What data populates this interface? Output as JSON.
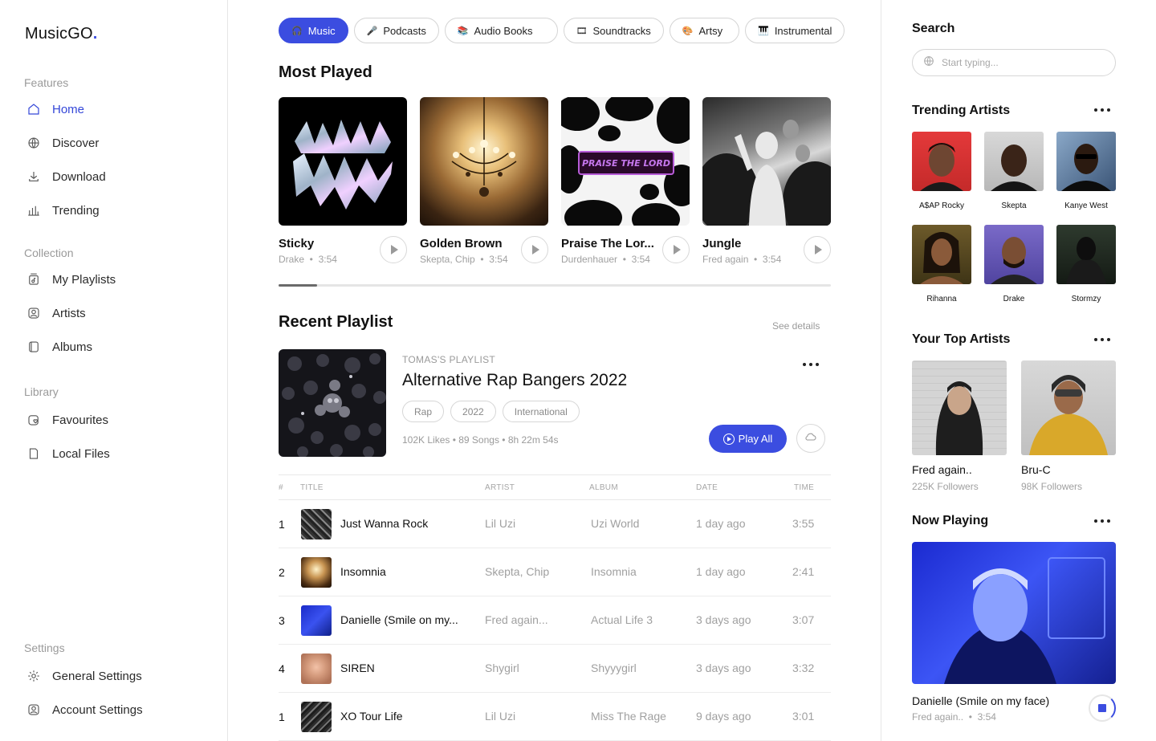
{
  "app": {
    "logo_main": "MusicGO",
    "logo_dot": "."
  },
  "sidebar": {
    "sections": {
      "features": "Features",
      "collection": "Collection",
      "library": "Library",
      "settings": "Settings"
    },
    "items": {
      "home": "Home",
      "discover": "Discover",
      "download": "Download",
      "trending": "Trending",
      "my_playlists": "My Playlists",
      "artists": "Artists",
      "albums": "Albums",
      "favourites": "Favourites",
      "local_files": "Local Files",
      "general_settings": "General Settings",
      "account_settings": "Account Settings"
    },
    "active_item": "home"
  },
  "categories": [
    {
      "label": "Music",
      "icon": "headphones-icon",
      "active": true
    },
    {
      "label": "Podcasts",
      "icon": "microphone-icon",
      "active": false
    },
    {
      "label": "Audio Books",
      "icon": "books-icon",
      "active": false
    },
    {
      "label": "Soundtracks",
      "icon": "film-icon",
      "active": false
    },
    {
      "label": "Artsy",
      "icon": "palette-icon",
      "active": false
    },
    {
      "label": "Instrumental",
      "icon": "piano-icon",
      "active": false
    }
  ],
  "most_played": {
    "heading": "Most Played",
    "items": [
      {
        "title": "Sticky",
        "artist": "Drake",
        "duration": "3:54"
      },
      {
        "title": "Golden Brown",
        "artist": "Skepta, Chip",
        "duration": "3:54"
      },
      {
        "title": "Praise The Lor...",
        "artist": "Durdenhauer",
        "duration": "3:54"
      },
      {
        "title": "Jungle",
        "artist": "Fred again",
        "duration": "3:54"
      }
    ],
    "scroll_progress": 0.07
  },
  "recent_playlist": {
    "heading": "Recent Playlist",
    "see_details": "See details",
    "kicker": "TOMAS'S PLAYLIST",
    "title": "Alternative Rap Bangers 2022",
    "tags": [
      "Rap",
      "2022",
      "International"
    ],
    "meta": "102K Likes • 89 Songs • 8h 22m 54s",
    "play_all": "Play All"
  },
  "track_table": {
    "headers": {
      "num": "#",
      "title": "TITLE",
      "artist": "ARTIST",
      "album": "ALBUM",
      "date": "DATE",
      "time": "TIME"
    },
    "rows": [
      {
        "num": "1",
        "title": "Just Wanna Rock",
        "artist": "Lil Uzi",
        "album": "Uzi World",
        "date": "1 day ago",
        "time": "3:55"
      },
      {
        "num": "2",
        "title": "Insomnia",
        "artist": "Skepta, Chip",
        "album": "Insomnia",
        "date": "1 day ago",
        "time": "2:41"
      },
      {
        "num": "3",
        "title": "Danielle (Smile on my...",
        "artist": "Fred again...",
        "album": "Actual Life 3",
        "date": "3 days ago",
        "time": "3:07"
      },
      {
        "num": "4",
        "title": "SIREN",
        "artist": "Shygirl",
        "album": "Shyyygirl",
        "date": "3 days ago",
        "time": "3:32"
      },
      {
        "num": "1",
        "title": "XO Tour Life",
        "artist": "Lil Uzi",
        "album": "Miss The Rage",
        "date": "9 days ago",
        "time": "3:01"
      }
    ]
  },
  "right_panel": {
    "search": {
      "heading": "Search",
      "placeholder": "Start typing..."
    },
    "trending_artists": {
      "heading": "Trending Artists",
      "artists": [
        "A$AP Rocky",
        "Skepta",
        "Kanye West",
        "Rihanna",
        "Drake",
        "Stormzy"
      ]
    },
    "top_artists": {
      "heading": "Your Top Artists",
      "artists": [
        {
          "name": "Fred again..",
          "followers": "225K Followers"
        },
        {
          "name": "Bru-C",
          "followers": "98K Followers"
        }
      ]
    },
    "now_playing": {
      "heading": "Now Playing",
      "title": "Danielle (Smile on my face)",
      "artist": "Fred again..",
      "duration": "3:54",
      "progress": 0.25
    }
  },
  "colors": {
    "accent": "#3b4de0",
    "muted": "#9a9a9a",
    "border": "#e6e6e6"
  }
}
